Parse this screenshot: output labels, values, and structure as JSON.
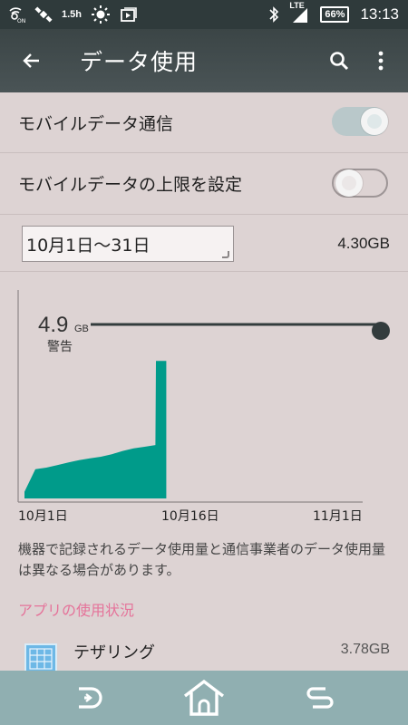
{
  "status_bar": {
    "left_icons": [
      "nfc-icon",
      "satellite-icon",
      "signal-text-icon",
      "brightness-icon",
      "media-icon"
    ],
    "network_label": "1.5h",
    "lte_label": "LTE",
    "battery_percent": "66%",
    "time": "13:13"
  },
  "app_bar": {
    "title": "データ使用"
  },
  "settings": {
    "mobile_data_label": "モバイルデータ通信",
    "mobile_data_enabled": true,
    "limit_label": "モバイルデータの上限を設定",
    "limit_enabled": false
  },
  "cycle": {
    "date_range": "10月1日〜31日",
    "total_usage": "4.30GB"
  },
  "chart_data": {
    "type": "area",
    "warning_value": "4.9",
    "warning_unit": "GB",
    "warning_label": "警告",
    "x_tick_labels": [
      "10月1日",
      "10月16日",
      "11月1日"
    ],
    "days": [
      1,
      2,
      3,
      4,
      5,
      6,
      7,
      8,
      9,
      10,
      11,
      12,
      13,
      13.05,
      14
    ],
    "values": [
      0.08,
      0.35,
      0.37,
      0.4,
      0.43,
      0.46,
      0.48,
      0.5,
      0.53,
      0.57,
      0.6,
      0.62,
      0.64,
      1.65,
      1.65
    ],
    "xlim": [
      1,
      32
    ],
    "ylim": [
      0,
      2.5
    ],
    "fill_color": "#009b8a"
  },
  "note": "機器で記録されるデータ使用量と通信事業者のデータ使用量は異なる場合があります。",
  "app_usage": {
    "header": "アプリの使用状況",
    "items": [
      {
        "name": "テザリング",
        "usage": "3.78GB"
      }
    ]
  },
  "colors": {
    "accent": "#009b8a",
    "header_pink": "#e5739a",
    "app_bar": "#3b4546"
  }
}
